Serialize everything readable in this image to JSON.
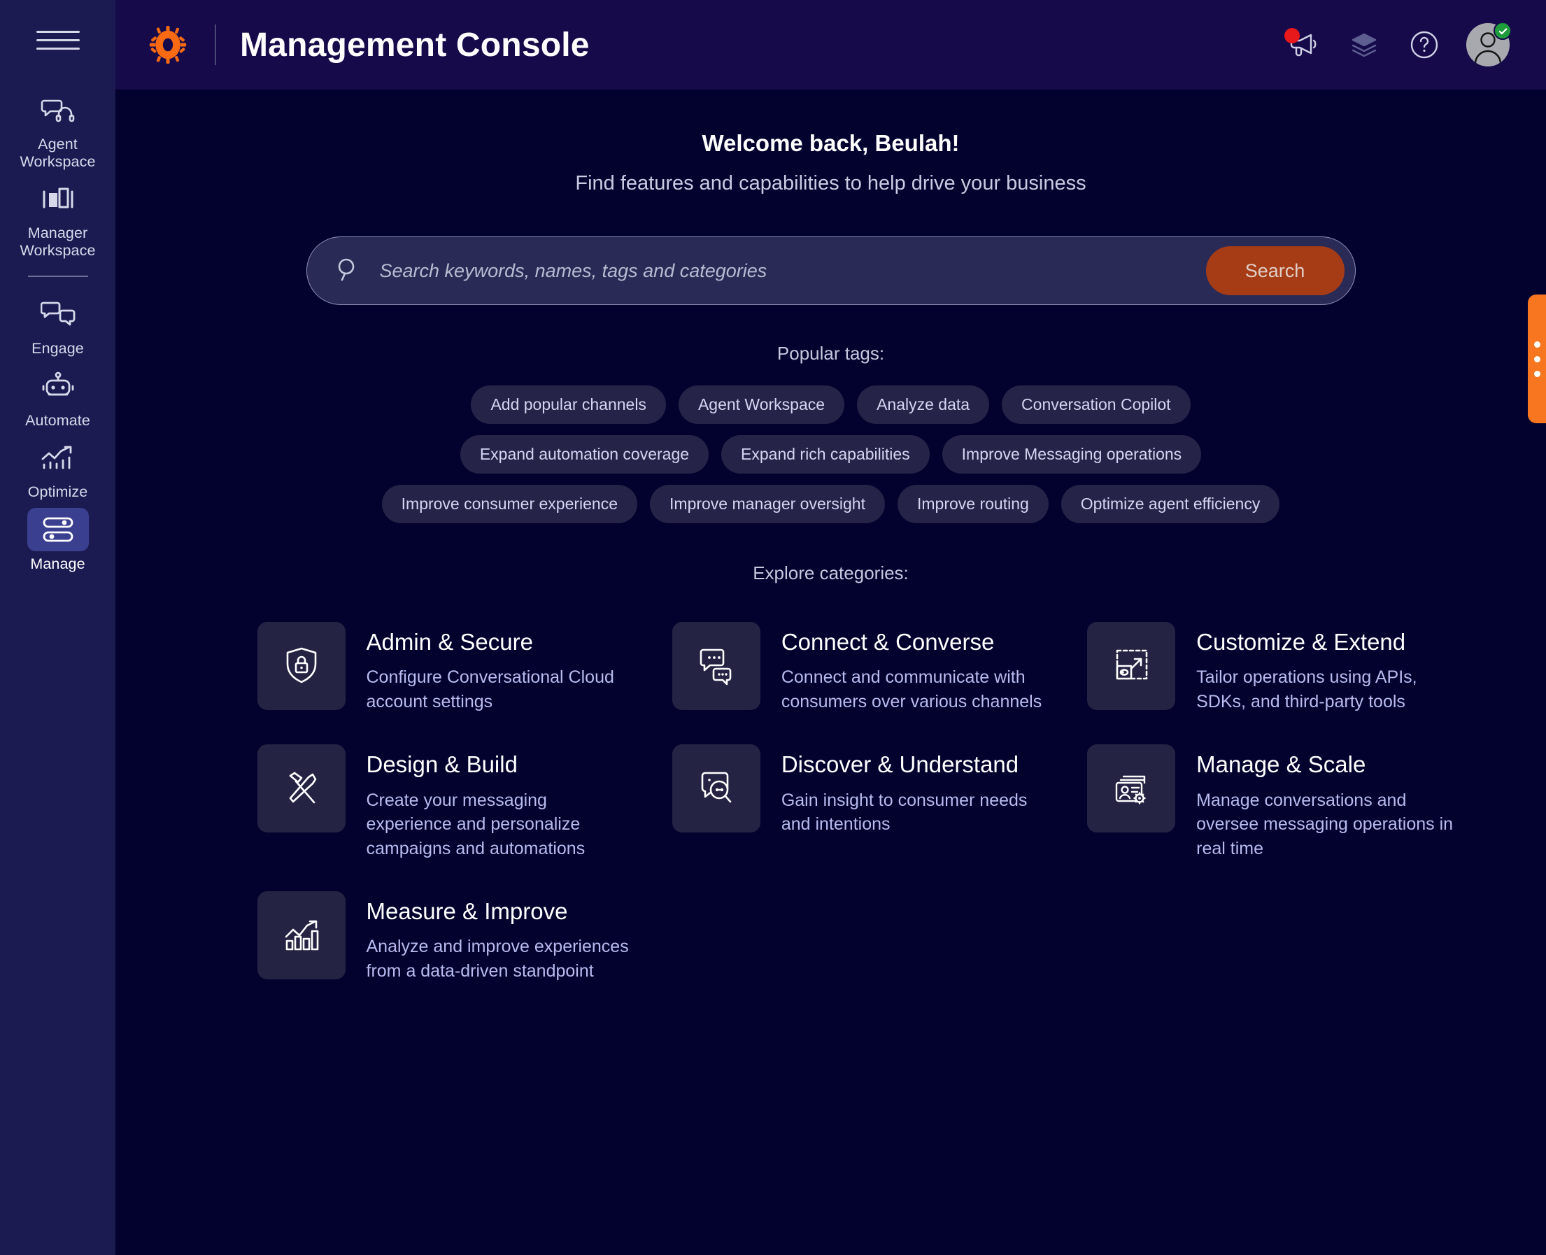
{
  "sidebar": {
    "menu_icon": "hamburger-icon",
    "items": [
      {
        "label": "Agent Workspace",
        "icon": "chat-headset-icon",
        "active": false
      },
      {
        "label": "Manager Workspace",
        "icon": "bar-chart-icon",
        "active": false
      },
      {
        "label": "Engage",
        "icon": "chat-bubbles-icon",
        "active": false
      },
      {
        "label": "Automate",
        "icon": "robot-icon",
        "active": false
      },
      {
        "label": "Optimize",
        "icon": "trend-up-icon",
        "active": false
      },
      {
        "label": "Manage",
        "icon": "sliders-icon",
        "active": true
      }
    ]
  },
  "header": {
    "logo": "gear-logo-icon",
    "title": "Management Console",
    "actions": [
      {
        "name": "announcements-megaphone-icon",
        "has_badge": true
      },
      {
        "name": "layers-icon",
        "has_badge": false
      },
      {
        "name": "help-question-icon",
        "has_badge": false
      }
    ],
    "avatar": {
      "name": "user-avatar",
      "status": "online",
      "status_icon": "check-icon"
    }
  },
  "main": {
    "welcome": "Welcome back, Beulah!",
    "subtitle": "Find features and capabilities to help drive your business",
    "search": {
      "placeholder": "Search keywords, names, tags and categories",
      "value": "",
      "button_label": "Search",
      "icon": "search-icon"
    },
    "tags_title": "Popular tags:",
    "tags": [
      "Add popular channels",
      "Agent Workspace",
      "Analyze data",
      "Conversation Copilot",
      "Expand automation coverage",
      "Expand rich capabilities",
      "Improve Messaging operations",
      "Improve consumer experience",
      "Improve manager oversight",
      "Improve routing",
      "Optimize agent efficiency"
    ],
    "explore_title": "Explore categories:",
    "categories": [
      {
        "title": "Admin & Secure",
        "desc": "Configure Conversational Cloud account settings",
        "icon": "shield-lock-icon"
      },
      {
        "title": "Connect & Converse",
        "desc": "Connect and communicate with consumers over various channels",
        "icon": "chat-bubbles-dots-icon"
      },
      {
        "title": "Customize & Extend",
        "desc": "Tailor operations using APIs, SDKs, and third-party tools",
        "icon": "extend-arrow-icon"
      },
      {
        "title": "Design & Build",
        "desc": "Create your messaging experience and personalize campaigns and automations",
        "icon": "hammer-screwdriver-icon"
      },
      {
        "title": "Discover & Understand",
        "desc": "Gain insight to consumer needs and intentions",
        "icon": "chat-magnify-icon"
      },
      {
        "title": "Manage & Scale",
        "desc": "Manage conversations and oversee messaging operations in real time",
        "icon": "user-cards-gear-icon"
      },
      {
        "title": "Measure & Improve",
        "desc": "Analyze and improve experiences from a data-driven standpoint",
        "icon": "chart-trend-icon"
      }
    ]
  },
  "feedback_tab": {
    "icon": "three-dots-icon"
  },
  "colors": {
    "page_bg": "#03022e",
    "sidebar_bg": "#1b1b52",
    "topbar_bg": "#160a4a",
    "accent_orange": "#f7761f",
    "search_button": "#a63c16",
    "tile_bg": "#252344",
    "tag_bg": "#262349",
    "active_nav": "#3b3f8f",
    "badge_red": "#e8191b",
    "status_green": "#1f9c3c"
  }
}
